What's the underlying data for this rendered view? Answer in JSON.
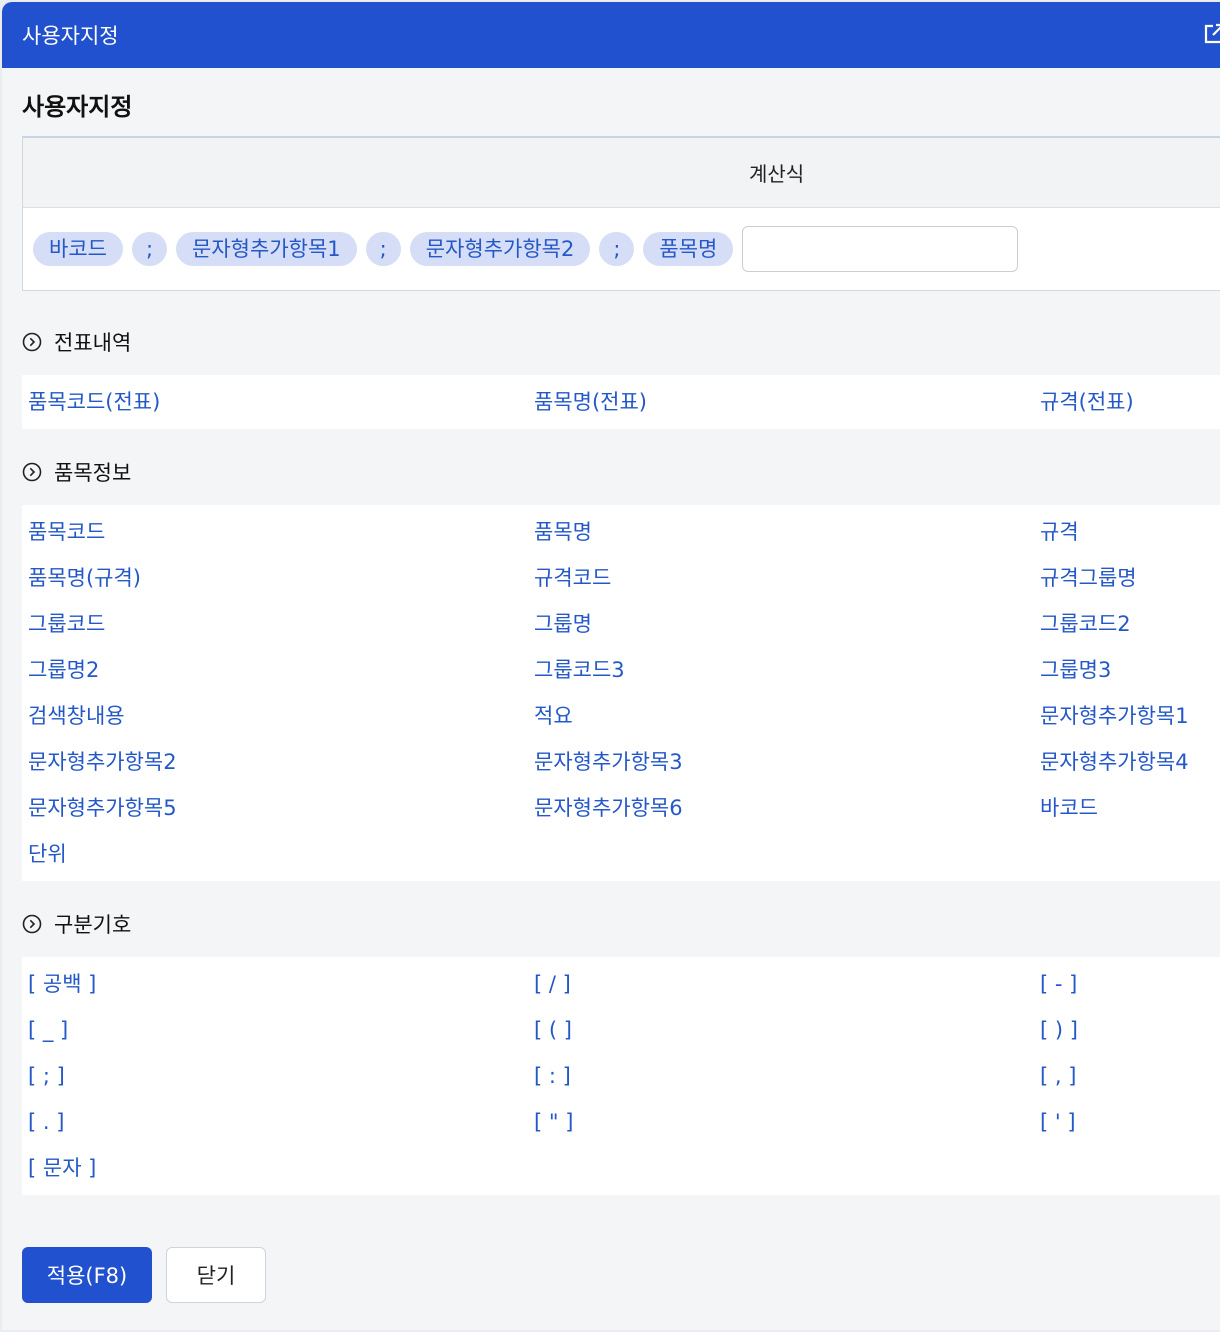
{
  "window": {
    "title": "사용자지정"
  },
  "page": {
    "title": "사용자지정"
  },
  "formula": {
    "header": "계산식",
    "chips": [
      "바코드",
      ";",
      "문자형추가항목1",
      ";",
      "문자형추가항목2",
      ";",
      "품목명"
    ],
    "input_value": ""
  },
  "sections": [
    {
      "title": "전표내역",
      "items": [
        "품목코드(전표)",
        "품목명(전표)",
        "규격(전표)"
      ]
    },
    {
      "title": "품목정보",
      "items": [
        "품목코드",
        "품목명",
        "규격",
        "품목명(규격)",
        "규격코드",
        "규격그룹명",
        "그룹코드",
        "그룹명",
        "그룹코드2",
        "그룹명2",
        "그룹코드3",
        "그룹명3",
        "검색창내용",
        "적요",
        "문자형추가항목1",
        "문자형추가항목2",
        "문자형추가항목3",
        "문자형추가항목4",
        "문자형추가항목5",
        "문자형추가항목6",
        "바코드",
        "단위"
      ]
    },
    {
      "title": "구분기호",
      "items": [
        "[ 공백 ]",
        "[ / ]",
        "[ - ]",
        "[ _ ]",
        "[ ( ]",
        "[ ) ]",
        "[ ; ]",
        "[ : ]",
        "[ , ]",
        "[ . ]",
        "[ \" ]",
        "[ ' ]",
        "[ 문자 ]"
      ]
    }
  ],
  "footer": {
    "apply_label": "적용(F8)",
    "close_label": "닫기"
  },
  "colors": {
    "primary": "#2251cf",
    "link": "#2458c8",
    "chip_bg": "#d5def6"
  },
  "icons": {
    "titlebar": "popout-icon",
    "section": "circle-chevron-right-icon"
  }
}
